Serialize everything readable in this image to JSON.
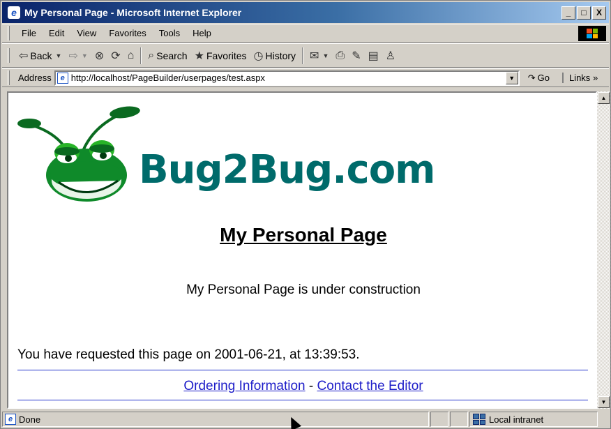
{
  "window": {
    "title": "My Personal Page - Microsoft Internet Explorer",
    "app_icon": "ie-icon",
    "controls": {
      "minimize": "_",
      "maximize": "□",
      "close": "X"
    }
  },
  "menu": {
    "items": [
      "File",
      "Edit",
      "View",
      "Favorites",
      "Tools",
      "Help"
    ]
  },
  "toolbar": {
    "back_label": "Back",
    "search_label": "Search",
    "favorites_label": "Favorites",
    "history_label": "History"
  },
  "address": {
    "label": "Address",
    "url": "http://localhost/PageBuilder/userpages/test.aspx",
    "go_label": "Go",
    "links_label": "Links"
  },
  "page": {
    "logo_text": "Bug2Bug.com",
    "heading": "My Personal Page",
    "construction_text": "My Personal Page is under construction",
    "requested_text": "You have requested this page on 2001-06-21, at 13:39:53.",
    "footer": {
      "ordering_link": "Ordering Information",
      "separator": " - ",
      "contact_link": "Contact the Editor"
    }
  },
  "status": {
    "text": "Done",
    "zone": "Local intranet"
  },
  "colors": {
    "titlebar_start": "#0a246a",
    "logo_green": "#006b6b",
    "link": "#1c1cc8",
    "rule": "#2233cc"
  }
}
